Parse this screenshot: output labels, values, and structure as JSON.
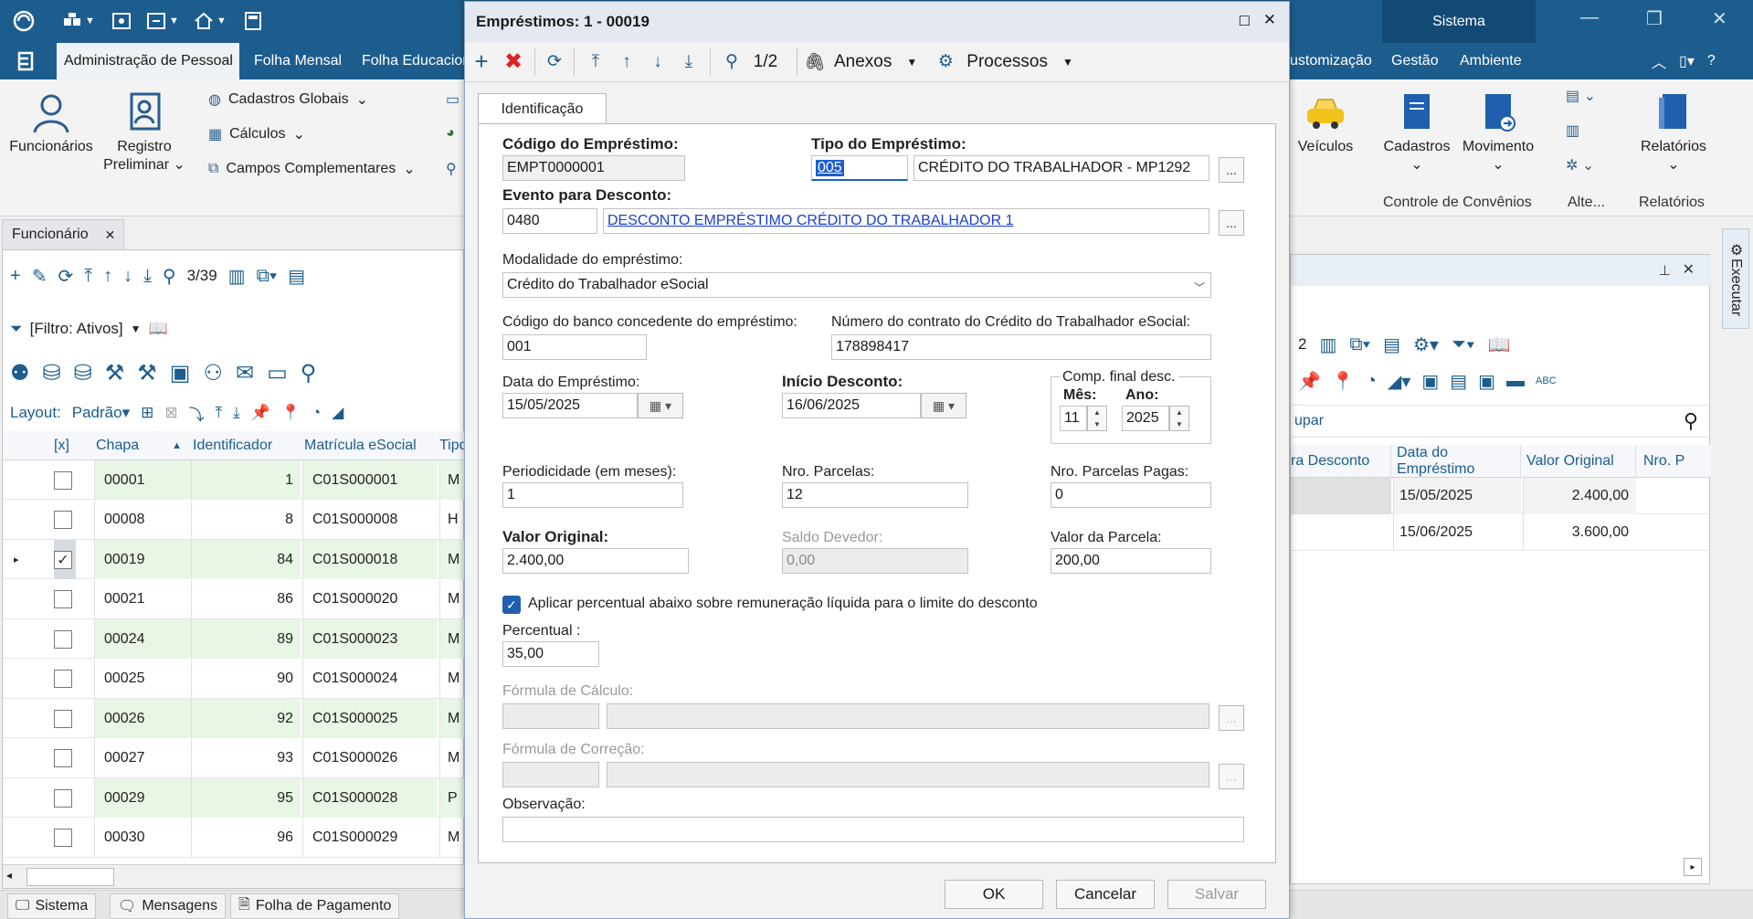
{
  "top": {
    "sistema": "Sistema",
    "menu": [
      "Administração de Pessoal",
      "Folha Mensal",
      "Folha Educacion",
      "ustomização",
      "Gestão",
      "Ambiente"
    ]
  },
  "ribbon": {
    "funcionarios": "Funcionários",
    "registro_l1": "Registro",
    "registro_l2": "Preliminar",
    "cadastros_globais": "Cadastros Globais",
    "calculos": "Cálculos",
    "campos_complementares": "Campos Complementares",
    "veiculos": "Veículos",
    "cadastros": "Cadastros",
    "movimento": "Movimento",
    "relatorios": "Relatórios",
    "group_convenios": "Controle de Convênios",
    "group_alte": "Alte...",
    "group_relatorios": "Relatórios"
  },
  "left": {
    "tab": "Funcionário",
    "nav_count": "3/39",
    "filter": "[Filtro: Ativos]",
    "layout_label": "Layout:",
    "layout_value": "Padrão",
    "columns": [
      "[x]",
      "Chapa",
      "Identificador",
      "Matrícula eSocial",
      "Tipo"
    ],
    "rows": [
      {
        "chapa": "00001",
        "ident": "1",
        "mat": "C01S000001",
        "tipo": "M",
        "checked": false
      },
      {
        "chapa": "00008",
        "ident": "8",
        "mat": "C01S000008",
        "tipo": "H",
        "checked": false
      },
      {
        "chapa": "00019",
        "ident": "84",
        "mat": "C01S000018",
        "tipo": "M",
        "checked": true
      },
      {
        "chapa": "00021",
        "ident": "86",
        "mat": "C01S000020",
        "tipo": "M",
        "checked": false
      },
      {
        "chapa": "00024",
        "ident": "89",
        "mat": "C01S000023",
        "tipo": "M",
        "checked": false
      },
      {
        "chapa": "00025",
        "ident": "90",
        "mat": "C01S000024",
        "tipo": "M",
        "checked": false
      },
      {
        "chapa": "00026",
        "ident": "92",
        "mat": "C01S000025",
        "tipo": "M",
        "checked": false
      },
      {
        "chapa": "00027",
        "ident": "93",
        "mat": "C01S000026",
        "tipo": "M",
        "checked": false
      },
      {
        "chapa": "00029",
        "ident": "95",
        "mat": "C01S000028",
        "tipo": "P",
        "checked": false
      },
      {
        "chapa": "00030",
        "ident": "96",
        "mat": "C01S000029",
        "tipo": "M",
        "checked": false
      }
    ]
  },
  "status": {
    "sistema": "Sistema",
    "mensagens": "Mensagens",
    "folha": "Folha de Pagamento"
  },
  "right": {
    "nav_fragment": "2",
    "search_fragment": "upar",
    "columns": [
      "ra Desconto",
      "Data do Empréstimo",
      "Valor Original",
      "Nro. P"
    ],
    "rows": [
      {
        "data": "15/05/2025",
        "valor": "2.400,00"
      },
      {
        "data": "15/06/2025",
        "valor": "3.600,00"
      }
    ],
    "executar": "Executar"
  },
  "dialog": {
    "title": "Empréstimos: 1 - 00019",
    "nav": "1/2",
    "anexos": "Anexos",
    "processos": "Processos",
    "tab": "Identificação",
    "codigo_label": "Código do Empréstimo:",
    "codigo_value": "EMPT0000001",
    "tipo_label": "Tipo do Empréstimo:",
    "tipo_code": "005",
    "tipo_desc": "CRÉDITO DO TRABALHADOR - MP1292",
    "evento_label": "Evento para Desconto:",
    "evento_code": "0480",
    "evento_desc": "DESCONTO EMPRÉSTIMO CRÉDITO DO TRABALHADOR 1",
    "modalidade_label": "Modalidade do empréstimo:",
    "modalidade_value": "Crédito do Trabalhador eSocial",
    "banco_label": "Código do banco concedente do empréstimo:",
    "banco_value": "001",
    "contrato_label": "Número do contrato do Crédito do Trabalhador eSocial:",
    "contrato_value": "178898417",
    "data_emp_label": "Data do Empréstimo:",
    "data_emp_value": "15/05/2025",
    "inicio_label": "Início Desconto:",
    "inicio_value": "16/06/2025",
    "comp_label": "Comp. final desc.",
    "mes_label": "Mês:",
    "mes_value": "11",
    "ano_label": "Ano:",
    "ano_value": "2025",
    "periodicidade_label": "Periodicidade (em meses):",
    "periodicidade_value": "1",
    "parcelas_label": "Nro. Parcelas:",
    "parcelas_value": "12",
    "pagas_label": "Nro. Parcelas Pagas:",
    "pagas_value": "0",
    "valor_label": "Valor Original:",
    "valor_value": "2.400,00",
    "saldo_label": "Saldo Devedor:",
    "saldo_value": "0,00",
    "parcela_label": "Valor da Parcela:",
    "parcela_value": "200,00",
    "aplicar_label": "Aplicar percentual abaixo sobre remuneração líquida para o limite do desconto",
    "percentual_label": "Percentual :",
    "percentual_value": "35,00",
    "formula_calc_label": "Fórmula de Cálculo:",
    "formula_corr_label": "Fórmula de Correção:",
    "observacao_label": "Observação:",
    "dots": "...",
    "ok": "OK",
    "cancelar": "Cancelar",
    "salvar": "Salvar"
  }
}
